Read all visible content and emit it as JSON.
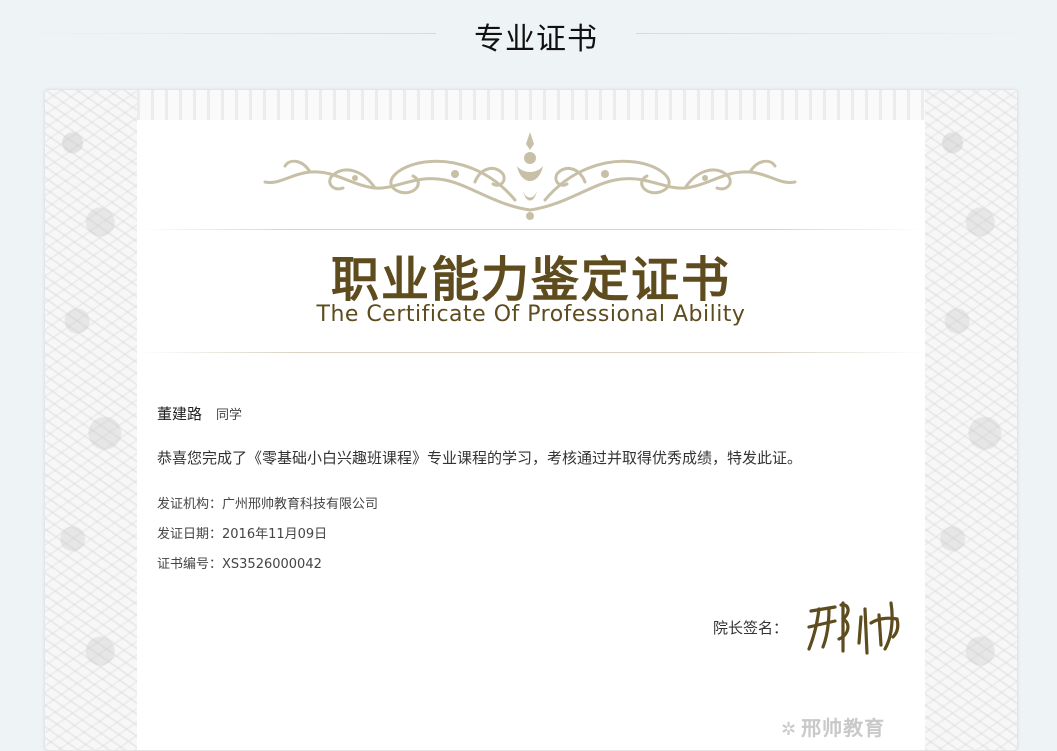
{
  "page": {
    "title": "专业证书"
  },
  "certificate": {
    "title": "职业能力鉴定证书",
    "subtitle": "The Certificate Of Professional Ability",
    "recipient_name": "董建路",
    "recipient_suffix": "同学",
    "congrats_text": "恭喜您完成了《零基础小白兴趣班课程》专业课程的学习，考核通过并取得优秀成绩，特发此证。",
    "issuer": "发证机构：广州邢帅教育科技有限公司",
    "issue_date": "发证日期：2016年11月09日",
    "cert_number": "证书编号：XS3526000042",
    "sign_label": "院长签名：",
    "signature_text": "邢帅",
    "watermark_text": "邢帅教育"
  },
  "colors": {
    "accent": "#5e4b1e",
    "background": "#eef3f6"
  }
}
